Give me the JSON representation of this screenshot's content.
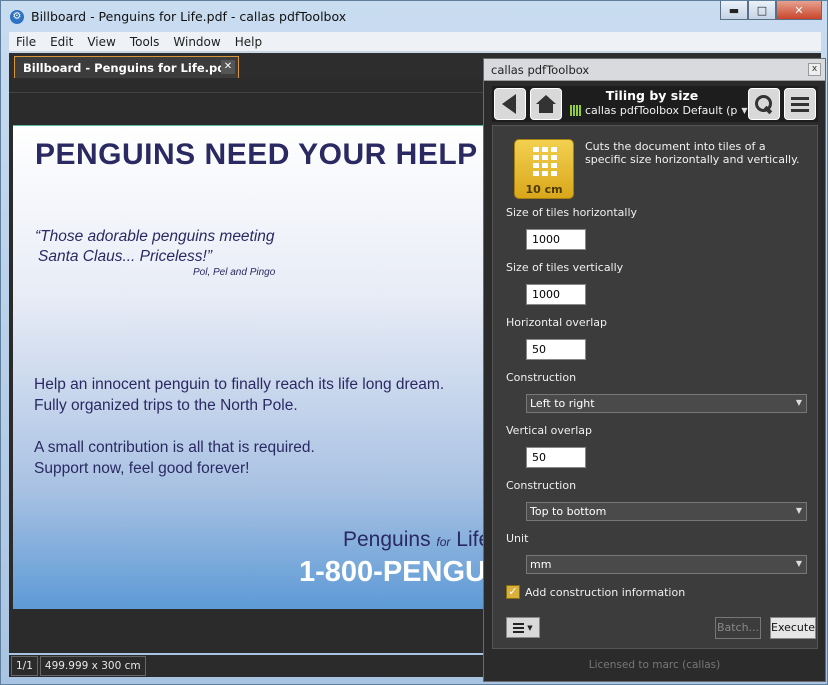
{
  "window": {
    "title": "Billboard - Penguins for Life.pdf - callas pdfToolbox",
    "minimize_glyph": "▬",
    "maximize_glyph": "□",
    "close_glyph": "✕"
  },
  "menu": [
    "File",
    "Edit",
    "View",
    "Tools",
    "Window",
    "Help"
  ],
  "document_tab": {
    "label": "Billboard - Penguins for Life.pdf",
    "close_glyph": "✕"
  },
  "pdf_page": {
    "headline": "PENGUINS NEED YOUR HELP -",
    "quote_line1": "“Those adorable penguins meeting",
    "quote_line2": "Santa Claus... Priceless!”",
    "quote_attribution": "Pol, Pel and Pingo",
    "body_line1": "Help an innocent penguin to finally reach its life long dream.",
    "body_line2": "Fully organized trips to the North Pole.",
    "body_line3": "A small contribution is all that is required.",
    "body_line4": "Support now, feel good forever!",
    "brand_part1": "Penguins",
    "brand_for": "for",
    "brand_part2": "Life",
    "phone": "1-800-PENGU"
  },
  "statusbar": {
    "page_indicator": "1/1",
    "page_size": "499.999 x 300 cm"
  },
  "panel": {
    "title": "callas pdfToolbox",
    "close_glyph": "x",
    "tool_name": "Tiling by size",
    "profile": "callas pdfToolbox Default (p",
    "tile_icon_label": "10 cm",
    "description": "Cuts the document into tiles of a specific size horizontally and vertically.",
    "fields": {
      "size_h_label": "Size of tiles horizontally",
      "size_h_value": "1000",
      "size_v_label": "Size of tiles vertically",
      "size_v_value": "1000",
      "overlap_h_label": "Horizontal overlap",
      "overlap_h_value": "50",
      "construction_h_label": "Construction",
      "construction_h_value": "Left to right",
      "overlap_v_label": "Vertical overlap",
      "overlap_v_value": "50",
      "construction_v_label": "Construction",
      "construction_v_value": "Top to bottom",
      "unit_label": "Unit",
      "unit_value": "mm"
    },
    "checkbox_label": "Add construction information",
    "checkbox_checked": true,
    "batch_label": "Batch...",
    "execute_label": "Execute",
    "license": "Licensed to marc (callas)"
  },
  "colors": {
    "accent_orange": "#d89638",
    "headline": "#2b2962",
    "profile_green": "#8fcf3a",
    "tile_yellow": "#e8bf35"
  }
}
